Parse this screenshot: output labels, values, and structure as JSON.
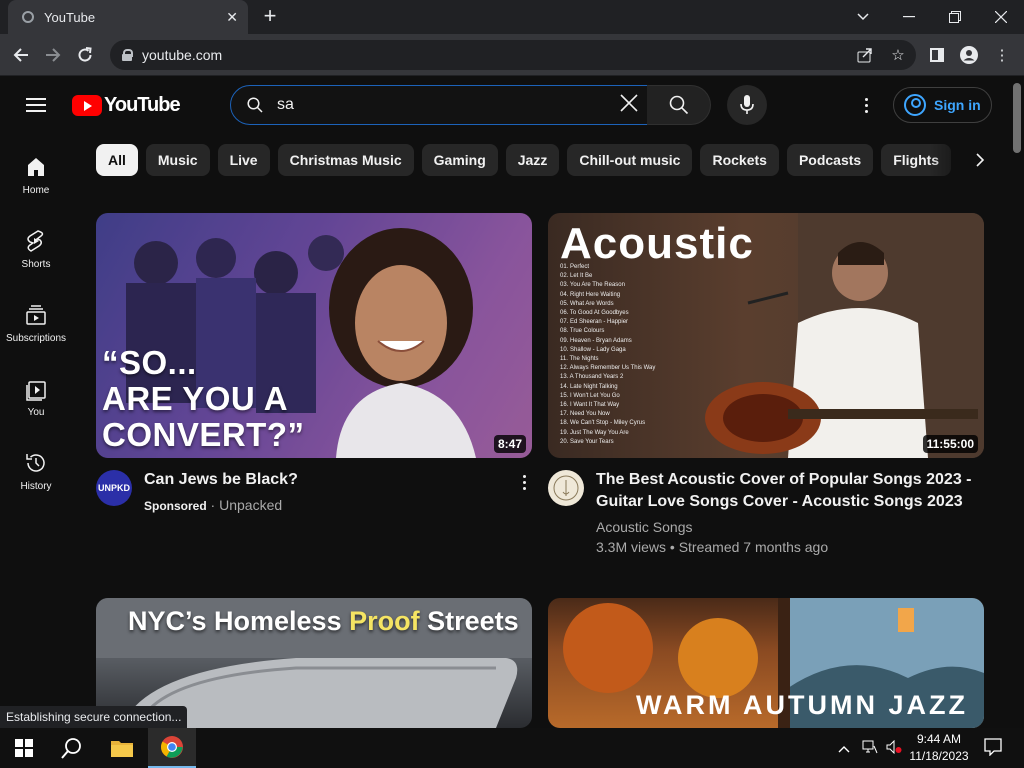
{
  "browser": {
    "tab_title": "YouTube",
    "url": "youtube.com"
  },
  "header": {
    "logo_text": "YouTube",
    "search_value": "sa",
    "signin_label": "Sign in"
  },
  "guide": [
    {
      "label": "Home",
      "icon": "home-icon"
    },
    {
      "label": "Shorts",
      "icon": "shorts-icon"
    },
    {
      "label": "Subscriptions",
      "icon": "subscriptions-icon"
    },
    {
      "label": "You",
      "icon": "you-icon"
    },
    {
      "label": "History",
      "icon": "history-icon"
    }
  ],
  "chips": [
    "All",
    "Music",
    "Live",
    "Christmas Music",
    "Gaming",
    "Jazz",
    "Chill-out music",
    "Rockets",
    "Podcasts",
    "Flights"
  ],
  "videos": [
    {
      "title": "Can Jews be Black?",
      "thumb_text": "“SO...\nARE YOU A\nCONVERT?”",
      "duration": "8:47",
      "sponsored": "Sponsored",
      "channel": "Unpacked",
      "avatar_text": "UNPKD"
    },
    {
      "title_line1": "The Best Acoustic Cover of Popular Songs 2023 -",
      "title_line2": "Guitar Love Songs Cover - Acoustic Songs 2023",
      "thumb_text": "Acoustic",
      "duration": "11:55:00",
      "channel": "Acoustic Songs",
      "meta": "3.3M views • Streamed 7 months ago",
      "tracklist": [
        "01. Perfect",
        "02. Let It Be",
        "03. You Are The Reason",
        "04. Right Here Waiting",
        "05. What Are Words",
        "06. To Good At Goodbyes",
        "07. Ed Sheeran - Happier",
        "08. True Colours",
        "09. Heaven - Bryan Adams",
        "10. Shallow - Lady Gaga",
        "11. The Nights",
        "12. Always Remember Us This Way",
        "13. A Thousand Years 2",
        "14. Late Night Talking",
        "15. I Won't Let You Go",
        "16. I Want It That Way",
        "17. Need You Now",
        "18. We Can't Stop - Miley Cyrus",
        "19. Just The Way You Are",
        "20. Save Your Tears"
      ]
    },
    {
      "thumb_text_a": "NYC’s Homeless ",
      "thumb_text_b": "Proof",
      "thumb_text_c": " Streets"
    },
    {
      "thumb_text": "WARM AUTUMN JAZZ"
    }
  ],
  "status_text": "Establishing secure connection...",
  "taskbar": {
    "time": "9:44 AM",
    "date": "11/18/2023"
  },
  "colors": {
    "yt_red": "#ff0000",
    "link_blue": "#3ea6ff",
    "search_focus": "#1c62b9",
    "background": "#0f0f0f"
  }
}
